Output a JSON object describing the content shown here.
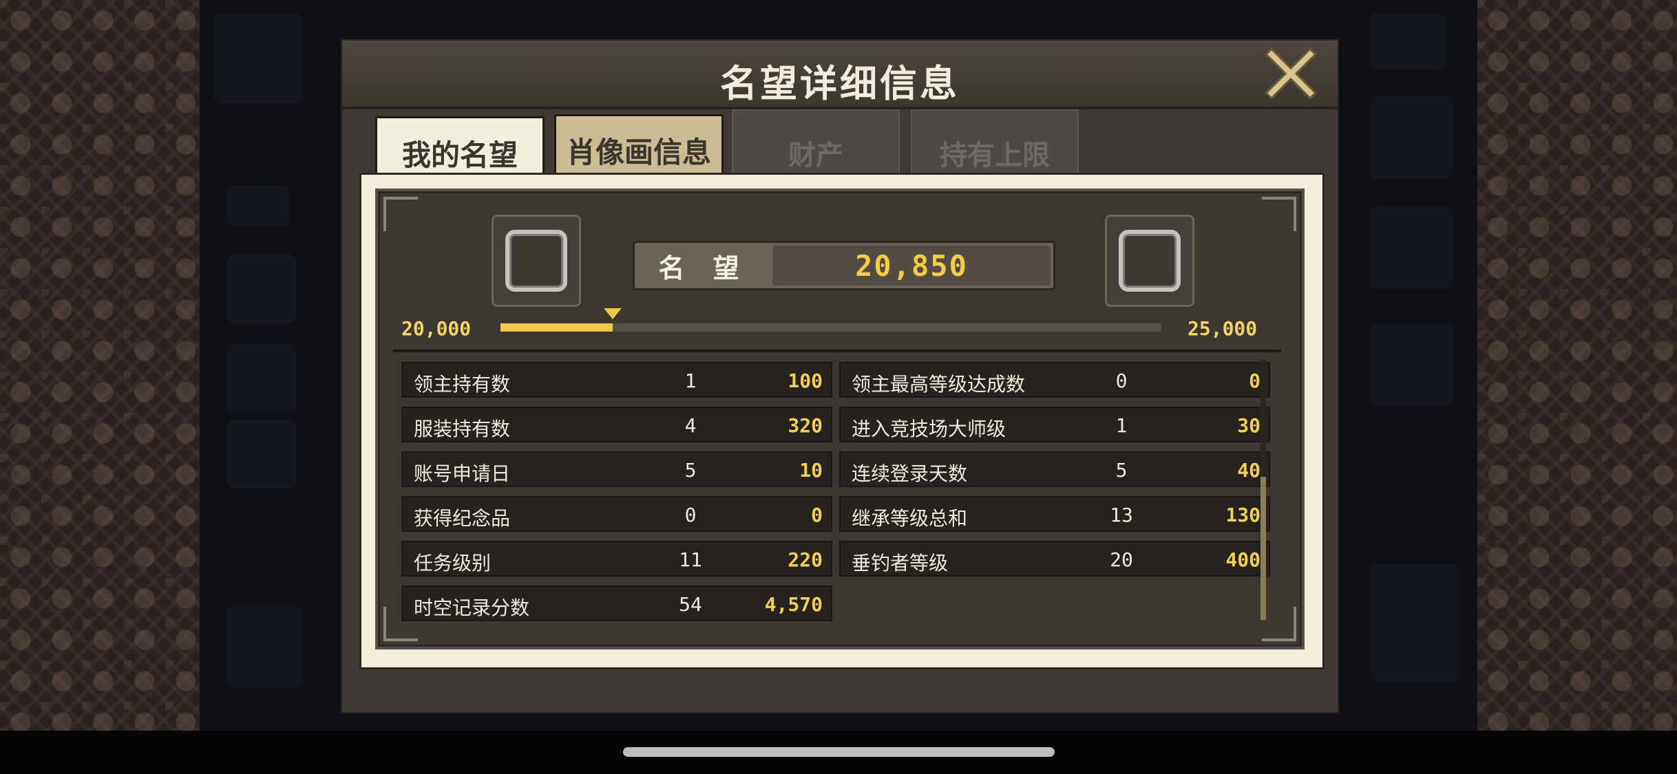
{
  "dialog": {
    "title": "名望详细信息",
    "tabs": [
      {
        "label": "我的名望",
        "active": true
      },
      {
        "label": "肖像画信息",
        "active": false
      }
    ],
    "background_tabs": [
      "财产",
      "持有上限"
    ]
  },
  "fame": {
    "label": "名 望",
    "value": "20,850",
    "range_min": "20,000",
    "range_max": "25,000",
    "progress_fraction": 0.17
  },
  "stats": {
    "left": [
      {
        "name": "领主持有数",
        "count": "1",
        "points": "100"
      },
      {
        "name": "服装持有数",
        "count": "4",
        "points": "320"
      },
      {
        "name": "账号申请日",
        "count": "5",
        "points": "10"
      },
      {
        "name": "获得纪念品",
        "count": "0",
        "points": "0"
      },
      {
        "name": "任务级别",
        "count": "11",
        "points": "220"
      },
      {
        "name": "时空记录分数",
        "count": "54",
        "points": "4,570"
      }
    ],
    "right": [
      {
        "name": "领主最高等级达成数",
        "count": "0",
        "points": "0"
      },
      {
        "name": "进入竞技场大师级",
        "count": "1",
        "points": "30"
      },
      {
        "name": "连续登录天数",
        "count": "5",
        "points": "40"
      },
      {
        "name": "继承等级总和",
        "count": "13",
        "points": "130"
      },
      {
        "name": "垂钓者等级",
        "count": "20",
        "points": "400"
      }
    ]
  },
  "colors": {
    "accent_gold": "#f2c64a",
    "panel_dark": "#3b3731",
    "frame_cream": "#f2edda"
  },
  "icons": {
    "close": "close-x-icon",
    "badge_left": "rank-badge-icon",
    "badge_right": "rank-badge-icon"
  }
}
